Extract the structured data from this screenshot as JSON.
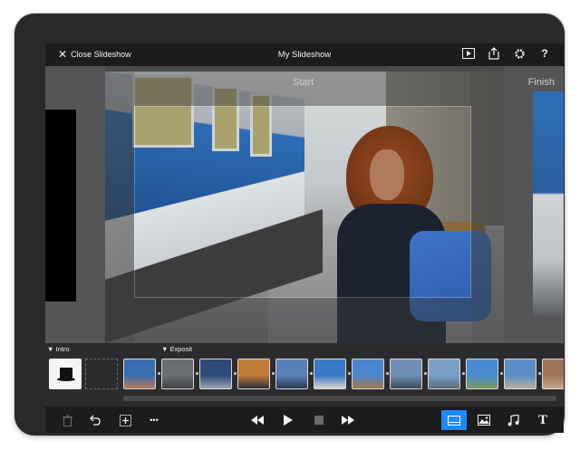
{
  "header": {
    "close_label": "Close Slideshow",
    "title": "My Slideshow",
    "icons": [
      "play-preview-icon",
      "share-icon",
      "settings-gear-icon",
      "help-icon"
    ],
    "help_glyph": "?"
  },
  "stage": {
    "start_label": "Start",
    "finish_label": "Finish"
  },
  "timeline": {
    "segments": [
      {
        "label": "▼ Intro"
      },
      {
        "label": "▼ Exposit"
      }
    ],
    "thumbs": [
      {
        "name": "intro-thumb",
        "kind": "intro"
      },
      {
        "name": "empty-slot",
        "kind": "gap"
      },
      {
        "name": "slide-thumb-1",
        "colors": [
          "#3a6eb3",
          "#b57a55"
        ]
      },
      {
        "name": "slide-thumb-2",
        "colors": [
          "#6b6e72",
          "#3f4144"
        ]
      },
      {
        "name": "slide-thumb-3",
        "colors": [
          "#2e4a7a",
          "#9aa3b0"
        ]
      },
      {
        "name": "slide-thumb-4",
        "colors": [
          "#c07a3a",
          "#2d2d33"
        ]
      },
      {
        "name": "slide-thumb-5",
        "colors": [
          "#5a7fb8",
          "#2b3a55"
        ]
      },
      {
        "name": "slide-thumb-6",
        "colors": [
          "#3a78c8",
          "#d9d4c8"
        ]
      },
      {
        "name": "slide-thumb-7",
        "colors": [
          "#4b86d0",
          "#a37a4a"
        ]
      },
      {
        "name": "slide-thumb-8",
        "colors": [
          "#6f8fb5",
          "#3d4a58"
        ]
      },
      {
        "name": "slide-thumb-9",
        "colors": [
          "#7aa0c8",
          "#5a6a7a"
        ]
      },
      {
        "name": "slide-thumb-10",
        "colors": [
          "#4a8ad0",
          "#7a9a5a"
        ]
      },
      {
        "name": "slide-thumb-11",
        "colors": [
          "#5b8ec4",
          "#b8b0a0"
        ]
      },
      {
        "name": "slide-thumb-12",
        "colors": [
          "#a0745a",
          "#c8a888"
        ]
      }
    ]
  },
  "toolbar": {
    "icons": [
      "trash-icon",
      "undo-icon",
      "add-slide-icon",
      "more-icon",
      "skip-back-icon",
      "play-icon",
      "stop-icon",
      "skip-forward-icon",
      "layout-icon",
      "photo-icon",
      "music-icon",
      "text-icon"
    ],
    "more_glyph": "•••",
    "text_glyph": "T"
  },
  "colors": {
    "accent": "#1e88ff",
    "chrome": "#1c1c1e",
    "stage": "#4a4a4c"
  }
}
